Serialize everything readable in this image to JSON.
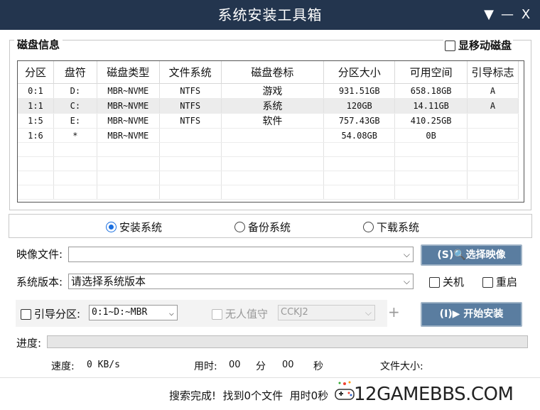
{
  "window": {
    "title": "系统安装工具箱",
    "menu_icon": "▼",
    "minimize_icon": "—",
    "close_icon": "X"
  },
  "disk_info": {
    "group_label": "磁盘信息",
    "show_mobile_label": "显移动磁盘",
    "columns": [
      "分区",
      "盘符",
      "磁盘类型",
      "文件系统",
      "磁盘卷标",
      "分区大小",
      "可用空间",
      "引导标志"
    ],
    "rows": [
      [
        "0:1",
        "D:",
        "MBR~NVME",
        "NTFS",
        "游戏",
        "931.51GB",
        "658.18GB",
        "A"
      ],
      [
        "1:1",
        "C:",
        "MBR~NVME",
        "NTFS",
        "系统",
        "120GB",
        "14.11GB",
        "A"
      ],
      [
        "1:5",
        "E:",
        "MBR~NVME",
        "NTFS",
        "软件",
        "757.43GB",
        "410.25GB",
        ""
      ],
      [
        "1:6",
        "*",
        "MBR~NVME",
        "",
        "",
        "54.08GB",
        "0B",
        ""
      ]
    ]
  },
  "modes": {
    "install": "安装系统",
    "backup": "备份系统",
    "download": "下载系统",
    "selected": "install"
  },
  "image": {
    "label": "映像文件:",
    "value": "",
    "select_button": "(S)🔍选择映像"
  },
  "version": {
    "label": "系统版本:",
    "value": "请选择系统版本",
    "shutdown": "关机",
    "restart": "重启"
  },
  "boot": {
    "label": "引导分区:",
    "value": "0:1~D:~MBR",
    "unattended": "无人值守",
    "user_value": "CCKJ2",
    "plus": "+",
    "install_button": "(I)▶ 开始安装"
  },
  "progress": {
    "label": "进度:",
    "fraction": 0
  },
  "stats": {
    "speed_label": "速度:",
    "speed_value": "0 KB/s",
    "time_label": "用时:",
    "minutes": "00",
    "min_unit": "分",
    "seconds": "00",
    "sec_unit": "秒",
    "size_label": "文件大小:"
  },
  "status": {
    "text": "搜索完成!  找到0个文件  用时0秒"
  },
  "watermark": {
    "text": "12GAMEBBS.COM"
  }
}
